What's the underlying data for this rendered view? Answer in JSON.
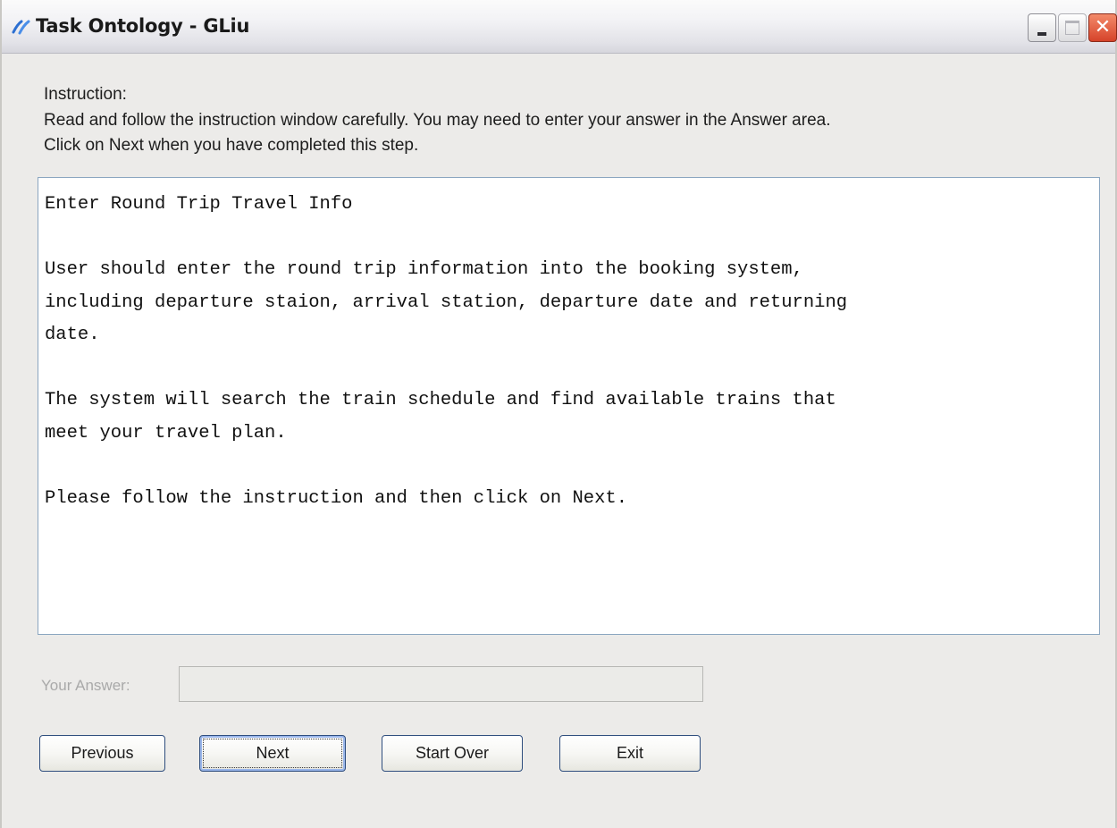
{
  "window": {
    "title": "Task Ontology - GLiu",
    "controls": {
      "minimize_icon": "minimize-icon",
      "maximize_icon": "maximize-icon",
      "close_icon": "close-icon",
      "close_glyph": "✕"
    }
  },
  "instruction": {
    "heading": "Instruction:",
    "line1": "Read and follow the instruction window carefully. You may need to enter your answer in the Answer area.",
    "line2": "Click on Next when you have completed this step."
  },
  "task_text": "Enter Round Trip Travel Info\n\nUser should enter the round trip information into the booking system,\nincluding departure staion, arrival station, departure date and returning\ndate.\n\nThe system will search the train schedule and find available trains that\nmeet your travel plan.\n\nPlease follow the instruction and then click on Next.",
  "answer": {
    "label": "Your Answer:",
    "value": "",
    "enabled": false
  },
  "buttons": {
    "previous": "Previous",
    "next": "Next",
    "start_over": "Start Over",
    "exit": "Exit"
  },
  "colors": {
    "window_bg": "#ecebe9",
    "panel_border": "#8ba6c0",
    "button_border": "#2f4e7e",
    "close_button": "#d6432a",
    "disabled_text": "#a9a9a9"
  }
}
